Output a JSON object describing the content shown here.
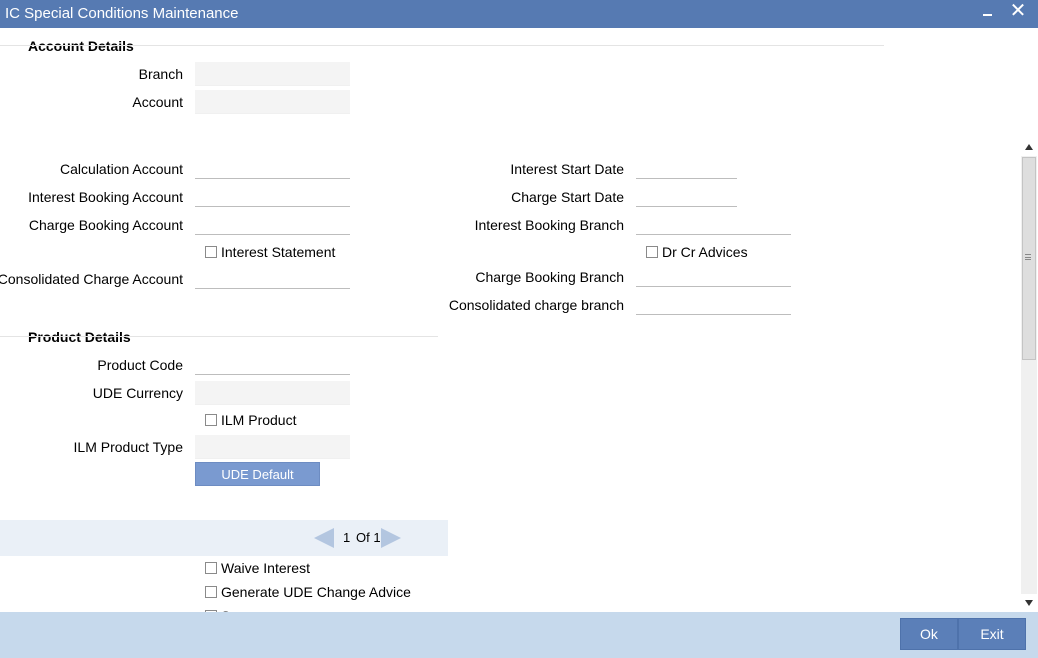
{
  "window": {
    "title": "IC Special Conditions Maintenance",
    "minimize_icon": "minimize-icon",
    "close_glyph": "✕"
  },
  "account_details": {
    "title": "Account Details",
    "branch_label": "Branch",
    "branch_value": "",
    "account_label": "Account",
    "account_value": ""
  },
  "accounts": {
    "calculation_account_label": "Calculation Account",
    "calculation_account_value": "",
    "interest_booking_account_label": "Interest Booking Account",
    "interest_booking_account_value": "",
    "charge_booking_account_label": "Charge Booking Account",
    "charge_booking_account_value": "",
    "interest_statement_label": "Interest Statement",
    "interest_statement_checked": false,
    "consolidated_charge_account_label": "Consolidated Charge Account",
    "consolidated_charge_account_value": "",
    "interest_start_date_label": "Interest Start Date",
    "interest_start_date_value": "",
    "charge_start_date_label": "Charge Start Date",
    "charge_start_date_value": "",
    "interest_booking_branch_label": "Interest Booking Branch",
    "interest_booking_branch_value": "",
    "dr_cr_advices_label": "Dr Cr Advices",
    "dr_cr_advices_checked": false,
    "charge_booking_branch_label": "Charge Booking Branch",
    "charge_booking_branch_value": "",
    "consolidated_charge_branch_label": "Consolidated charge branch",
    "consolidated_charge_branch_value": ""
  },
  "product_details": {
    "title": "Product Details",
    "product_code_label": "Product Code",
    "product_code_value": "",
    "ude_currency_label": "UDE Currency",
    "ude_currency_value": "",
    "ilm_product_label": "ILM Product",
    "ilm_product_checked": false,
    "ilm_product_type_label": "ILM Product Type",
    "ilm_product_type_value": "",
    "ude_default_button": "UDE Default"
  },
  "pagination": {
    "current": "1",
    "of_label": "Of 1"
  },
  "options": {
    "waive_interest_label": "Waive Interest",
    "waive_interest_checked": false,
    "generate_ude_change_advice_label": "Generate UDE Change Advice",
    "generate_ude_change_advice_checked": false,
    "partial_checkbox_label": "S"
  },
  "footer": {
    "ok_label": "Ok",
    "exit_label": "Exit"
  },
  "colors": {
    "titlebar": "#567ab2",
    "footer": "#c6d9ec",
    "button": "#5b7fb8",
    "ude_button": "#7a9ad0",
    "pager_bg": "#eaf0f7"
  }
}
